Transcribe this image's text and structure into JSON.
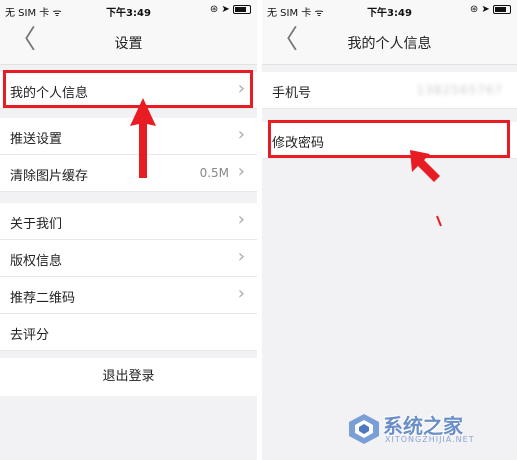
{
  "status_bar": {
    "carrier": "无 SIM 卡 ᯤ",
    "time": "下午3:49"
  },
  "left_screen": {
    "nav_title": "设置",
    "back_glyph": "〈",
    "items": [
      {
        "label": "我的个人信息"
      },
      {
        "label": "推送设置"
      },
      {
        "label": "清除图片缓存",
        "value": "0.5M"
      },
      {
        "label": "关于我们"
      },
      {
        "label": "版权信息"
      },
      {
        "label": "推荐二维码"
      },
      {
        "label": "去评分"
      }
    ],
    "logout_label": "退出登录"
  },
  "right_screen": {
    "nav_title": "我的个人信息",
    "back_glyph": "〈",
    "items": [
      {
        "label": "手机号",
        "value": "1382565767"
      },
      {
        "label": "修改密码"
      }
    ]
  },
  "colors": {
    "highlight": "#e81c23",
    "background": "#f2f2f4"
  },
  "watermark": {
    "text": "系统之家",
    "url": "XITONGZHIJIA.NET"
  }
}
